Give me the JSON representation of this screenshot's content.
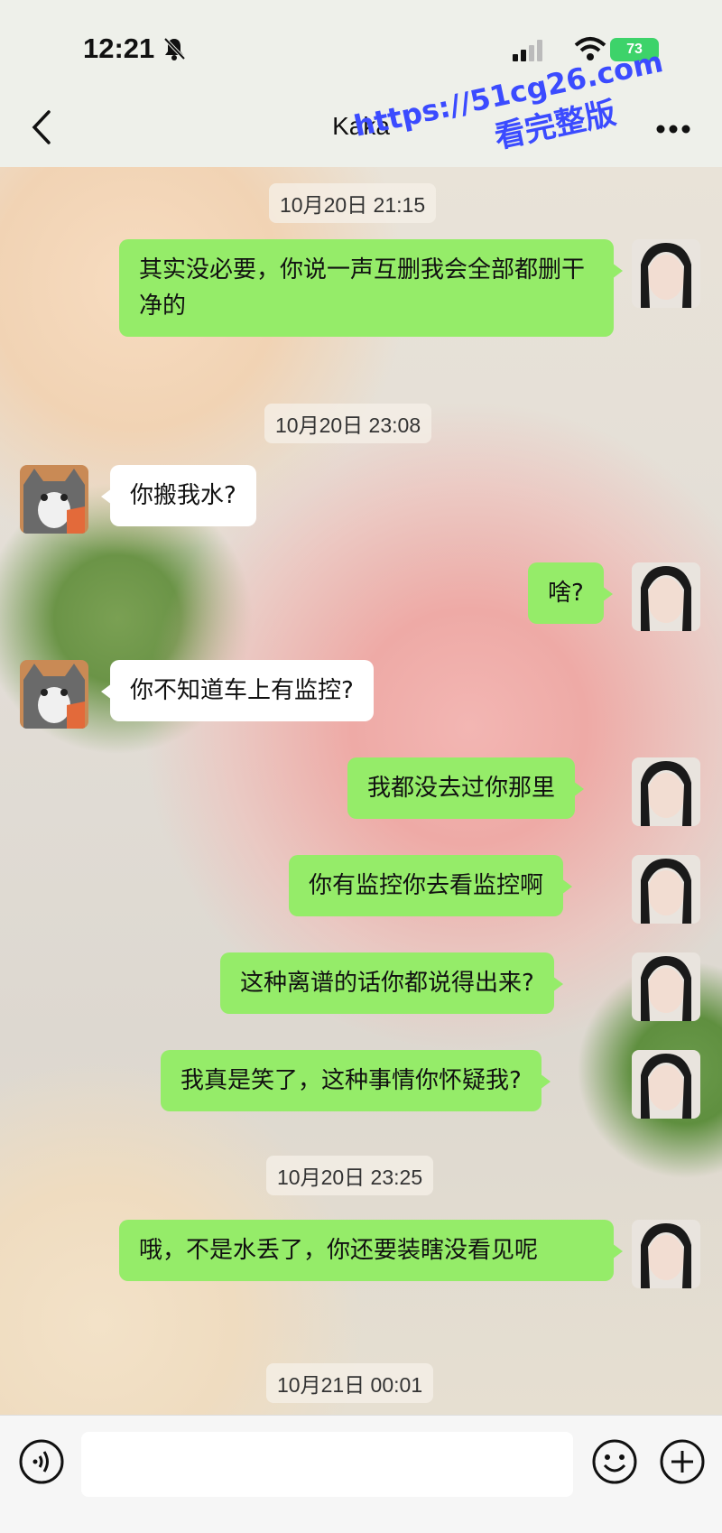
{
  "status_bar": {
    "time": "12:21",
    "battery": "73"
  },
  "header": {
    "title": "Kaka"
  },
  "watermark": {
    "line1": "https://51cg26.com",
    "line2": "看完整版"
  },
  "messages": [
    {
      "type": "time",
      "text": "10月20日 21:15"
    },
    {
      "type": "msg",
      "from": "me",
      "text": "其实没必要，你说一声互删我会全部都删干净的"
    },
    {
      "type": "time",
      "text": "10月20日 23:08"
    },
    {
      "type": "msg",
      "from": "other",
      "text": "你搬我水?"
    },
    {
      "type": "msg",
      "from": "me",
      "text": "啥?"
    },
    {
      "type": "msg",
      "from": "other",
      "text": "你不知道车上有监控?"
    },
    {
      "type": "msg",
      "from": "me",
      "text": "我都没去过你那里"
    },
    {
      "type": "msg",
      "from": "me",
      "text": "你有监控你去看监控啊"
    },
    {
      "type": "msg",
      "from": "me",
      "text": "这种离谱的话你都说得出来?"
    },
    {
      "type": "msg",
      "from": "me",
      "text": "我真是笑了，这种事情你怀疑我?"
    },
    {
      "type": "time",
      "text": "10月20日 23:25"
    },
    {
      "type": "msg",
      "from": "me",
      "text": "哦，不是水丢了，你还要装瞎没看见呢"
    },
    {
      "type": "time",
      "text": "10月21日 00:01"
    }
  ],
  "colors": {
    "my_bubble": "#95ec69",
    "other_bubble": "#ffffff",
    "watermark": "#3b4bff"
  },
  "icons": {
    "back": "chevron-left-icon",
    "more": "more-dots-icon",
    "voice": "voice-icon",
    "emoji": "emoji-icon",
    "plus": "plus-icon"
  }
}
